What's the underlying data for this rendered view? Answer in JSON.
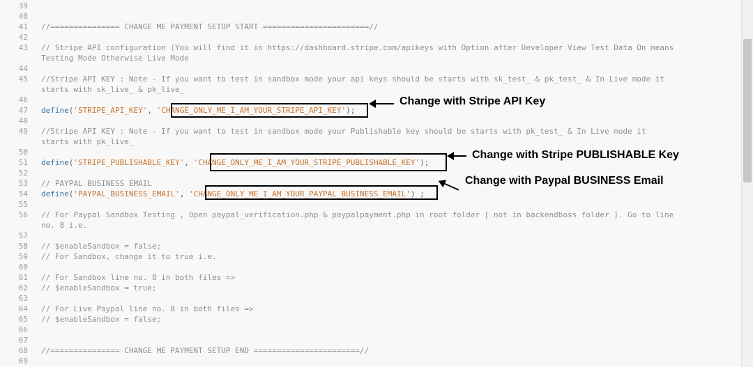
{
  "lines": [
    {
      "n": "39",
      "t": ""
    },
    {
      "n": "40",
      "t": ""
    },
    {
      "n": "41",
      "t": "//=============== CHANGE ME PAYMENT SETUP START =======================//"
    },
    {
      "n": "42",
      "t": ""
    },
    {
      "n": "43",
      "t": "// Stripe API configuration (You will find it in https://dashboard.stripe.com/apikeys with Option after Developer View Test Data On means"
    },
    {
      "n": "",
      "t": "Testing Mode Otherwise Live Mode"
    },
    {
      "n": "44",
      "t": ""
    },
    {
      "n": "45",
      "t": "//Stripe API KEY : Note - If you want to test in sandbox mode your api keys should be starts with sk_test_ & pk_test_ & In Live mode it"
    },
    {
      "n": "",
      "t": "starts with sk_live_ & pk_live_"
    },
    {
      "n": "46",
      "t": ""
    },
    {
      "n": "47",
      "define": "define",
      "p1": "(",
      "s1": "'STRIPE_API_KEY'",
      "p2": ", ",
      "s2": "'CHANGE_ONLY_ME_I_AM_YOUR_STRIPE_API_KEY'",
      "p3": ");"
    },
    {
      "n": "48",
      "t": ""
    },
    {
      "n": "49",
      "t": "//Stripe API KEY : Note - If you want to test in sandbox mode your Publishable key should be starts with pk_test_ & In Live mode it"
    },
    {
      "n": "",
      "t": "starts with pk_live_"
    },
    {
      "n": "50",
      "t": ""
    },
    {
      "n": "51",
      "define": "define",
      "p1": "(",
      "s1": "'STRIPE_PUBLISHABLE_KEY'",
      "p2": ", ",
      "s2": "'CHANGE_ONLY_ME_I_AM_YOUR_STRIPE_PUBLISHABLE_KEY'",
      "p3": ");"
    },
    {
      "n": "52",
      "t": ""
    },
    {
      "n": "53",
      "t": "// PAYPAL BUSINESS EMAIL"
    },
    {
      "n": "54",
      "define": "define",
      "p1": "(",
      "s1": "'PAYPAL_BUSINESS_EMAIL'",
      "p2": ", ",
      "s2": "'CHANGE_ONLY_ME_I_AM_YOUR_PAYPAL_BUSINESS_EMAIL'",
      "p3": ") ;"
    },
    {
      "n": "55",
      "t": ""
    },
    {
      "n": "56",
      "t": "// For Paypal Sandbox Testing , Open paypal_verification.php & paypalpayment.php in root folder [ not in backendboss folder ]. Go to line"
    },
    {
      "n": "",
      "t": "no. 8 i.e."
    },
    {
      "n": "57",
      "t": ""
    },
    {
      "n": "58",
      "t": "// $enableSandbox = false;"
    },
    {
      "n": "59",
      "t": "// For Sandbox, change it to true i.e."
    },
    {
      "n": "60",
      "t": ""
    },
    {
      "n": "61",
      "t": "// For Sandbox line no. 8 in both files =>"
    },
    {
      "n": "62",
      "t": "// $enableSandbox = true;"
    },
    {
      "n": "63",
      "t": ""
    },
    {
      "n": "64",
      "t": "// For Live Paypal line no. 8 in both files =>"
    },
    {
      "n": "65",
      "t": "// $enableSandbox = false;"
    },
    {
      "n": "66",
      "t": ""
    },
    {
      "n": "67",
      "t": ""
    },
    {
      "n": "68",
      "t": "//=============== CHANGE ME PAYMENT SETUP END =======================//"
    },
    {
      "n": "69",
      "t": ""
    }
  ],
  "annotations": {
    "stripe_api_key": "Change with Stripe API Key",
    "stripe_publishable_key": "Change with Stripe PUBLISHABLE Key",
    "paypal_business_email": "Change with Paypal BUSINESS Email"
  },
  "colors": {
    "comment": "#8f8f8f",
    "keyword": "#3a75a8",
    "string": "#c8742c",
    "line_number": "#9a9a9a",
    "background": "#f8f8f8"
  }
}
